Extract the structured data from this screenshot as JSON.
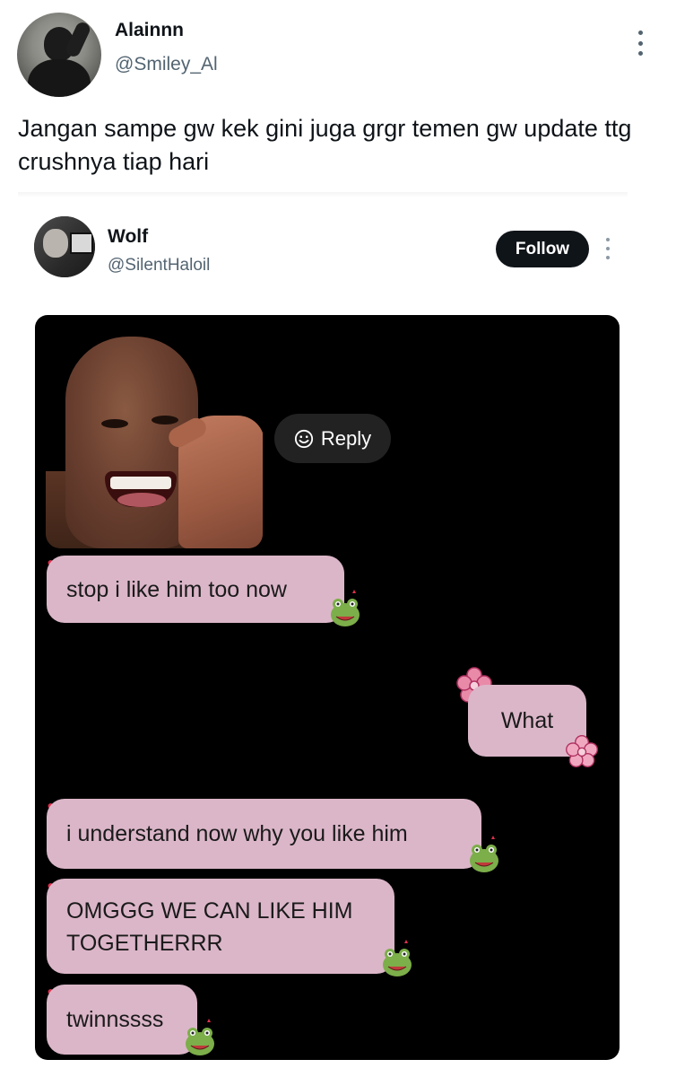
{
  "tweet": {
    "display_name": "Alainnn",
    "handle": "@Smiley_Al",
    "text": "Jangan sampe gw kek gini juga grgr temen gw update ttg crushnya tiap hari"
  },
  "quoted_tweet": {
    "display_name": "Wolf",
    "handle": "@SilentHaloil",
    "follow_label": "Follow"
  },
  "media": {
    "reply_label": "Reply",
    "messages": [
      {
        "side": "left",
        "text": "stop i like him too now"
      },
      {
        "side": "right",
        "text": "What"
      },
      {
        "side": "left",
        "text": "i understand now why you like him"
      },
      {
        "side": "left",
        "text": "OMGGG WE CAN LIKE HIM TOGETHERRR"
      },
      {
        "side": "left",
        "text": "twinnssss"
      }
    ]
  },
  "colors": {
    "bubble": "#dbb6c8",
    "follow_bg": "#0f1419",
    "secondary_text": "#536471"
  }
}
